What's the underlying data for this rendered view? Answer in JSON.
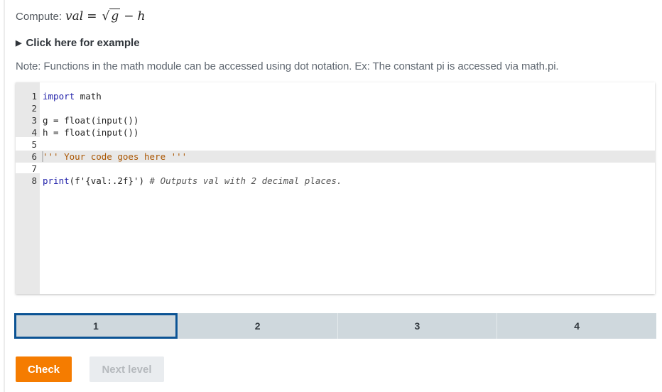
{
  "prompt": {
    "label": "Compute:",
    "formula": {
      "lhs": "val",
      "equals": "=",
      "sqrt_symbol": "√",
      "radicand": "g",
      "minus": "−",
      "rhs": "h"
    }
  },
  "example_toggle": {
    "icon": "triangle-right-icon",
    "glyph": "▶",
    "label": "Click here for example"
  },
  "note": "Note: Functions in the math module can be accessed using dot notation. Ex: The constant pi is accessed via math.pi.",
  "editor": {
    "lines": [
      {
        "number": "1",
        "tokens": [
          {
            "t": "import",
            "c": "kw"
          },
          {
            "t": " math",
            "c": ""
          }
        ]
      },
      {
        "number": "2",
        "tokens": []
      },
      {
        "number": "3",
        "tokens": [
          {
            "t": "g = float(input())",
            "c": ""
          }
        ]
      },
      {
        "number": "4",
        "tokens": [
          {
            "t": "h = float(input())",
            "c": ""
          }
        ]
      },
      {
        "number": "5",
        "tokens": []
      },
      {
        "number": "6",
        "tokens": [
          {
            "t": "''' Your code goes here '''",
            "c": "str"
          }
        ],
        "active": true
      },
      {
        "number": "7",
        "tokens": []
      },
      {
        "number": "8",
        "tokens": [
          {
            "t": "print",
            "c": "kw"
          },
          {
            "t": "(f'{val:.2f}') ",
            "c": ""
          },
          {
            "t": "# Outputs val with 2 decimal places.",
            "c": "cm"
          }
        ]
      }
    ]
  },
  "levels": {
    "tabs": [
      {
        "label": "1",
        "selected": true
      },
      {
        "label": "2",
        "selected": false
      },
      {
        "label": "3",
        "selected": false
      },
      {
        "label": "4",
        "selected": false
      }
    ]
  },
  "buttons": {
    "check_label": "Check",
    "next_label": "Next level",
    "next_disabled": true
  },
  "colors": {
    "accent_orange": "#f57c00",
    "selected_tab_border": "#0b5394",
    "tab_bg": "#cfd8dd",
    "disabled_bg": "#e9ecef"
  }
}
